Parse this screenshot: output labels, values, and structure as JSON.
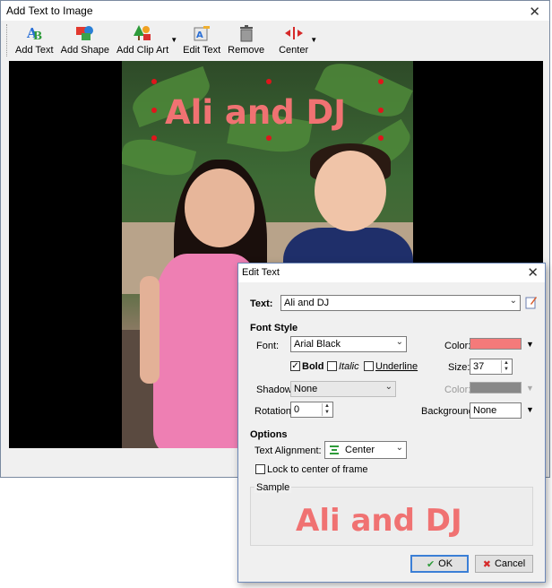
{
  "main_window": {
    "title": "Add Text to Image",
    "toolbar": {
      "add_text": "Add Text",
      "add_shape": "Add Shape",
      "add_clip_art": "Add Clip Art",
      "edit_text": "Edit Text",
      "remove": "Remove",
      "center": "Center"
    },
    "overlay_text": "Ali and DJ"
  },
  "dialog": {
    "title": "Edit Text",
    "text_label": "Text:",
    "text_value": "Ali and DJ",
    "font_style_heading": "Font Style",
    "font_label": "Font:",
    "font_value": "Arial Black",
    "color_label": "Color:",
    "color_value": "#f47a7a",
    "bold_label": "Bold",
    "italic_label": "Italic",
    "underline_label": "Underline",
    "size_label": "Size:",
    "size_value": "37",
    "shadow_label": "Shadow:",
    "shadow_value": "None",
    "shadow_color_label": "Color:",
    "rotation_label": "Rotation:",
    "rotation_value": "0",
    "background_label": "Background:",
    "background_value": "None",
    "options_heading": "Options",
    "alignment_label": "Text Alignment:",
    "alignment_value": "Center",
    "lock_label": "Lock to center of frame",
    "sample_heading": "Sample",
    "sample_text": "Ali and DJ",
    "ok_label": "OK",
    "cancel_label": "Cancel"
  },
  "colors": {
    "text_color": "#f07272",
    "shadow_color_disabled": "#888888",
    "accent": "#3b7fd6"
  }
}
